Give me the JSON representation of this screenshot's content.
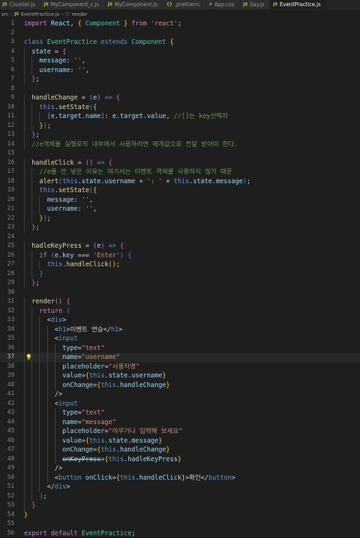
{
  "tabs": [
    {
      "icon": "JS",
      "label": "Counter.js",
      "active": false
    },
    {
      "icon": "JS",
      "label": "MyComponent_c.js",
      "active": false
    },
    {
      "icon": "JS",
      "label": "MyComponent.js",
      "active": false
    },
    {
      "icon": "{}",
      "label": ".prettierrc",
      "active": false
    },
    {
      "icon": "#",
      "label": "App.css",
      "active": false
    },
    {
      "icon": "JS",
      "label": "Say.js",
      "active": false
    },
    {
      "icon": "JS",
      "label": "EventPractice.js",
      "active": true
    }
  ],
  "breadcrumb": {
    "folder": "src",
    "file_icon": "JS",
    "file": "EventPractice.js",
    "symbol_icon": "⬡",
    "symbol": "render",
    "separator": "›"
  },
  "editor": {
    "current_line": 37,
    "lightbulb_line": 37,
    "lines": [
      [
        [
          "kw2",
          "import "
        ],
        [
          "var",
          "React"
        ],
        [
          "punc",
          ", "
        ],
        [
          "br1",
          "{ "
        ],
        [
          "cls",
          "Component"
        ],
        [
          "br1",
          " }"
        ],
        [
          "kw2",
          " from "
        ],
        [
          "str",
          "'react'"
        ],
        [
          "punc",
          ";"
        ]
      ],
      [],
      [
        [
          "kw",
          "class "
        ],
        [
          "cls",
          "EventPractice "
        ],
        [
          "kw",
          "extends "
        ],
        [
          "cls",
          "Component "
        ],
        [
          "br1",
          "{"
        ]
      ],
      [
        [
          "punc",
          "  "
        ],
        [
          "var",
          "state"
        ],
        [
          "punc",
          " = "
        ],
        [
          "br2",
          "{"
        ]
      ],
      [
        [
          "punc",
          "    "
        ],
        [
          "var",
          "message"
        ],
        [
          "punc",
          ": "
        ],
        [
          "str",
          "''"
        ],
        [
          "punc",
          ","
        ]
      ],
      [
        [
          "punc",
          "    "
        ],
        [
          "var",
          "username"
        ],
        [
          "punc",
          ": "
        ],
        [
          "str",
          "''"
        ],
        [
          "punc",
          ","
        ]
      ],
      [
        [
          "punc",
          "  "
        ],
        [
          "br2",
          "}"
        ],
        [
          "punc",
          ";"
        ]
      ],
      [],
      [
        [
          "punc",
          "  "
        ],
        [
          "fn",
          "handleChange"
        ],
        [
          "punc",
          " = "
        ],
        [
          "br2",
          "("
        ],
        [
          "var",
          "e"
        ],
        [
          "br2",
          ")"
        ],
        [
          "kw",
          " => "
        ],
        [
          "br2",
          "{"
        ]
      ],
      [
        [
          "punc",
          "    "
        ],
        [
          "kw",
          "this"
        ],
        [
          "punc",
          "."
        ],
        [
          "fn",
          "setState"
        ],
        [
          "br3",
          "("
        ],
        [
          "br1",
          "{"
        ]
      ],
      [
        [
          "punc",
          "      "
        ],
        [
          "br2",
          "["
        ],
        [
          "var",
          "e"
        ],
        [
          "punc",
          "."
        ],
        [
          "var",
          "target"
        ],
        [
          "punc",
          "."
        ],
        [
          "var",
          "name"
        ],
        [
          "br2",
          "]"
        ],
        [
          "punc",
          ": "
        ],
        [
          "var",
          "e"
        ],
        [
          "punc",
          "."
        ],
        [
          "var",
          "target"
        ],
        [
          "punc",
          "."
        ],
        [
          "var",
          "value"
        ],
        [
          "punc",
          ", "
        ],
        [
          "cmt",
          "//[]는 key선택자"
        ]
      ],
      [
        [
          "punc",
          "    "
        ],
        [
          "br1",
          "}"
        ],
        [
          "br3",
          ")"
        ],
        [
          "punc",
          ";"
        ]
      ],
      [
        [
          "punc",
          "  "
        ],
        [
          "br2",
          "}"
        ],
        [
          "punc",
          ";"
        ]
      ],
      [
        [
          "punc",
          "  "
        ],
        [
          "cmt",
          "//e객체를 실행로직 내부에서 사용하려면 매개값으로 전달 받아야 한다."
        ]
      ],
      [],
      [
        [
          "punc",
          "  "
        ],
        [
          "fn",
          "handleClick"
        ],
        [
          "punc",
          " = "
        ],
        [
          "br2",
          "()"
        ],
        [
          "kw",
          " => "
        ],
        [
          "br2",
          "{"
        ]
      ],
      [
        [
          "punc",
          "    "
        ],
        [
          "cmt",
          "//e를 안 넣은 이유는 여기서는 이벤트 객체를 사용하지 않기 때문"
        ]
      ],
      [
        [
          "punc",
          "    "
        ],
        [
          "fn",
          "alert"
        ],
        [
          "br3",
          "("
        ],
        [
          "kw",
          "this"
        ],
        [
          "punc",
          "."
        ],
        [
          "var",
          "state"
        ],
        [
          "punc",
          "."
        ],
        [
          "var",
          "username"
        ],
        [
          "punc",
          " + "
        ],
        [
          "str",
          "': '"
        ],
        [
          "punc",
          " + "
        ],
        [
          "kw",
          "this"
        ],
        [
          "punc",
          "."
        ],
        [
          "var",
          "state"
        ],
        [
          "punc",
          "."
        ],
        [
          "var",
          "message"
        ],
        [
          "br3",
          ")"
        ],
        [
          "punc",
          ";"
        ]
      ],
      [
        [
          "punc",
          "    "
        ],
        [
          "kw",
          "this"
        ],
        [
          "punc",
          "."
        ],
        [
          "fn",
          "setState"
        ],
        [
          "br3",
          "("
        ],
        [
          "br1",
          "{"
        ]
      ],
      [
        [
          "punc",
          "      "
        ],
        [
          "var",
          "message"
        ],
        [
          "punc",
          ": "
        ],
        [
          "str",
          "''"
        ],
        [
          "punc",
          ","
        ]
      ],
      [
        [
          "punc",
          "      "
        ],
        [
          "var",
          "username"
        ],
        [
          "punc",
          ": "
        ],
        [
          "str",
          "''"
        ],
        [
          "punc",
          ","
        ]
      ],
      [
        [
          "punc",
          "    "
        ],
        [
          "br1",
          "}"
        ],
        [
          "br3",
          ")"
        ],
        [
          "punc",
          ";"
        ]
      ],
      [
        [
          "punc",
          "  "
        ],
        [
          "br2",
          "}"
        ],
        [
          "punc",
          ";"
        ]
      ],
      [],
      [
        [
          "punc",
          "  "
        ],
        [
          "fn",
          "hadleKeyPress"
        ],
        [
          "punc",
          " = "
        ],
        [
          "br2",
          "("
        ],
        [
          "var",
          "e"
        ],
        [
          "br2",
          ")"
        ],
        [
          "kw",
          " => "
        ],
        [
          "br2",
          "{"
        ]
      ],
      [
        [
          "punc",
          "    "
        ],
        [
          "kw2",
          "if "
        ],
        [
          "br3",
          "("
        ],
        [
          "var",
          "e"
        ],
        [
          "punc",
          "."
        ],
        [
          "var",
          "key"
        ],
        [
          "punc",
          " === "
        ],
        [
          "str",
          "'Enter'"
        ],
        [
          "br3",
          ")"
        ],
        [
          "punc",
          " "
        ],
        [
          "br3",
          "{"
        ]
      ],
      [
        [
          "punc",
          "      "
        ],
        [
          "kw",
          "this"
        ],
        [
          "punc",
          "."
        ],
        [
          "fn",
          "handleClick"
        ],
        [
          "br1",
          "()"
        ],
        [
          "punc",
          ";"
        ]
      ],
      [
        [
          "punc",
          "    "
        ],
        [
          "br3",
          "}"
        ]
      ],
      [
        [
          "punc",
          "  "
        ],
        [
          "br2",
          "}"
        ],
        [
          "punc",
          ";"
        ]
      ],
      [],
      [
        [
          "punc",
          "  "
        ],
        [
          "fn",
          "render"
        ],
        [
          "br2",
          "()"
        ],
        [
          "punc",
          " "
        ],
        [
          "br2",
          "{"
        ]
      ],
      [
        [
          "punc",
          "    "
        ],
        [
          "kw2",
          "return "
        ],
        [
          "br3",
          "("
        ]
      ],
      [
        [
          "punc",
          "      "
        ],
        [
          "punc",
          "<"
        ],
        [
          "tag",
          "div"
        ],
        [
          "punc",
          ">"
        ]
      ],
      [
        [
          "punc",
          "        "
        ],
        [
          "punc",
          "<"
        ],
        [
          "tag",
          "h1"
        ],
        [
          "punc",
          ">"
        ],
        [
          "punc",
          "이벤트 연습"
        ],
        [
          "punc",
          "</"
        ],
        [
          "tag",
          "h1"
        ],
        [
          "punc",
          ">"
        ]
      ],
      [
        [
          "punc",
          "        "
        ],
        [
          "punc",
          "<"
        ],
        [
          "tag",
          "input"
        ]
      ],
      [
        [
          "punc",
          "          "
        ],
        [
          "attr",
          "type"
        ],
        [
          "punc",
          "="
        ],
        [
          "str",
          "\"text\""
        ]
      ],
      [
        [
          "punc",
          "          "
        ],
        [
          "attr",
          "name"
        ],
        [
          "punc",
          "="
        ],
        [
          "str",
          "\"username\""
        ]
      ],
      [
        [
          "punc",
          "          "
        ],
        [
          "attr",
          "placeholder"
        ],
        [
          "punc",
          "="
        ],
        [
          "str",
          "\"사용자명\""
        ]
      ],
      [
        [
          "punc",
          "          "
        ],
        [
          "attr",
          "value"
        ],
        [
          "punc",
          "="
        ],
        [
          "br1",
          "{"
        ],
        [
          "kw",
          "this"
        ],
        [
          "punc",
          "."
        ],
        [
          "var",
          "state"
        ],
        [
          "punc",
          "."
        ],
        [
          "var",
          "username"
        ],
        [
          "br1",
          "}"
        ]
      ],
      [
        [
          "punc",
          "          "
        ],
        [
          "attr",
          "onChange"
        ],
        [
          "punc",
          "="
        ],
        [
          "br1",
          "{"
        ],
        [
          "kw",
          "this"
        ],
        [
          "punc",
          "."
        ],
        [
          "var",
          "handleChange"
        ],
        [
          "br1",
          "}"
        ]
      ],
      [
        [
          "punc",
          "        "
        ],
        [
          "punc",
          "/>"
        ]
      ],
      [
        [
          "punc",
          "        "
        ],
        [
          "punc",
          "<"
        ],
        [
          "tag",
          "input"
        ]
      ],
      [
        [
          "punc",
          "          "
        ],
        [
          "attr",
          "type"
        ],
        [
          "punc",
          "="
        ],
        [
          "str",
          "\"text\""
        ]
      ],
      [
        [
          "punc",
          "          "
        ],
        [
          "attr",
          "name"
        ],
        [
          "punc",
          "="
        ],
        [
          "str",
          "\"message\""
        ]
      ],
      [
        [
          "punc",
          "          "
        ],
        [
          "attr",
          "placeholder"
        ],
        [
          "punc",
          "="
        ],
        [
          "str",
          "\"아무거나 입력해 보세요\""
        ]
      ],
      [
        [
          "punc",
          "          "
        ],
        [
          "attr",
          "value"
        ],
        [
          "punc",
          "="
        ],
        [
          "br1",
          "{"
        ],
        [
          "kw",
          "this"
        ],
        [
          "punc",
          "."
        ],
        [
          "var",
          "state"
        ],
        [
          "punc",
          "."
        ],
        [
          "var",
          "message"
        ],
        [
          "br1",
          "}"
        ]
      ],
      [
        [
          "punc",
          "          "
        ],
        [
          "attr",
          "onChange"
        ],
        [
          "punc",
          "="
        ],
        [
          "br1",
          "{"
        ],
        [
          "kw",
          "this"
        ],
        [
          "punc",
          "."
        ],
        [
          "var",
          "handleChange"
        ],
        [
          "br1",
          "}"
        ]
      ],
      [
        [
          "punc",
          "          "
        ],
        [
          "strike",
          "onKeyPress"
        ],
        [
          "punc",
          "="
        ],
        [
          "br1",
          "{"
        ],
        [
          "kw",
          "this"
        ],
        [
          "punc",
          "."
        ],
        [
          "var",
          "hadleKeyPress"
        ],
        [
          "br1",
          "}"
        ]
      ],
      [
        [
          "punc",
          "        "
        ],
        [
          "punc",
          "/>"
        ]
      ],
      [
        [
          "punc",
          "        "
        ],
        [
          "punc",
          "<"
        ],
        [
          "tag",
          "button"
        ],
        [
          "punc",
          " "
        ],
        [
          "attr",
          "onClick"
        ],
        [
          "punc",
          "="
        ],
        [
          "br1",
          "{"
        ],
        [
          "kw",
          "this"
        ],
        [
          "punc",
          "."
        ],
        [
          "var",
          "handleClick"
        ],
        [
          "br1",
          "}"
        ],
        [
          "punc",
          ">"
        ],
        [
          "punc",
          "확인"
        ],
        [
          "punc",
          "</"
        ],
        [
          "tag",
          "button"
        ],
        [
          "punc",
          ">"
        ]
      ],
      [
        [
          "punc",
          "      "
        ],
        [
          "punc",
          "</"
        ],
        [
          "tag",
          "div"
        ],
        [
          "punc",
          ">"
        ]
      ],
      [
        [
          "punc",
          "    "
        ],
        [
          "br3",
          ")"
        ],
        [
          "punc",
          ";"
        ]
      ],
      [
        [
          "punc",
          "  "
        ],
        [
          "br2",
          "}"
        ]
      ],
      [
        [
          "br1",
          "}"
        ]
      ],
      [],
      [
        [
          "kw2",
          "export "
        ],
        [
          "kw2",
          "default "
        ],
        [
          "cls",
          "EventPractice"
        ],
        [
          "punc",
          ";"
        ]
      ]
    ]
  }
}
